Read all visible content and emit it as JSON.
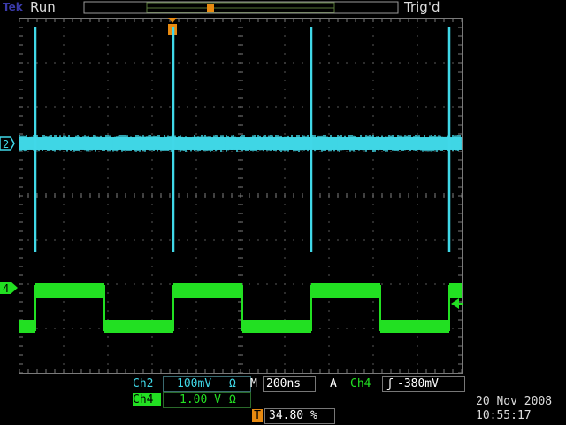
{
  "header": {
    "brand": "Tek",
    "status": "Run",
    "trigger_status": "Trig'd"
  },
  "channels": {
    "ch2": {
      "marker": "2",
      "name": "Ch2",
      "scale": "100mV",
      "coupling_symbol": "Ω",
      "color": "#40d8e8"
    },
    "ch4": {
      "marker": "4",
      "name": "Ch4",
      "scale": "1.00 V",
      "coupling_symbol": "Ω",
      "color": "#22e022"
    }
  },
  "timebase": {
    "label": "M",
    "value": "200ns"
  },
  "trigger": {
    "mode": "A",
    "source": "Ch4",
    "slope_symbol": "ʃ",
    "level": "-380mV"
  },
  "trigger_position": {
    "marker": "T",
    "value": "34.80 %"
  },
  "datetime": {
    "date": "20 Nov 2008",
    "time": "10:55:17"
  },
  "colors": {
    "grid": "#7a7a7a",
    "trigger_marker": "#e88a10",
    "frame": "#9a9a9a"
  }
}
